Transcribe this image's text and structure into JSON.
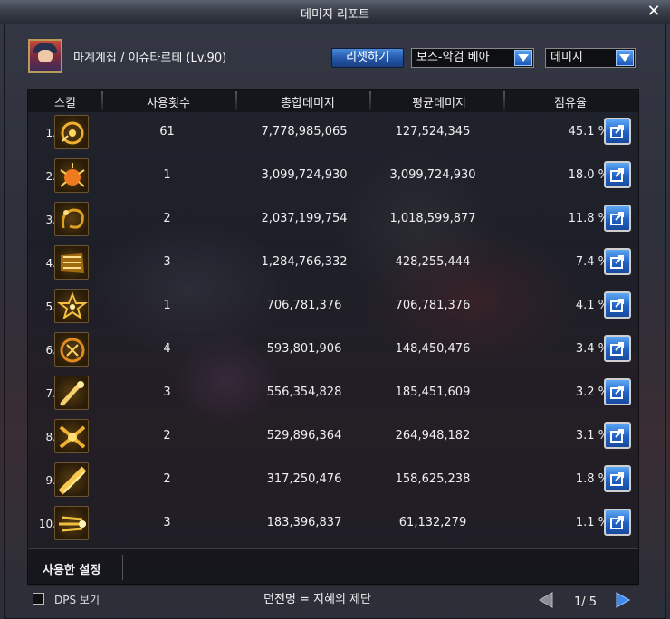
{
  "window": {
    "title": "데미지 리포트",
    "close_symbol": "✕"
  },
  "character": {
    "name": "마계계집 / 이슈타르테 (Lv.90)"
  },
  "controls": {
    "reset_label": "리셋하기",
    "target_select": "보스-악검 베아",
    "metric_select": "데미지"
  },
  "columns": {
    "skill": "스킬",
    "use_count": "사용횟수",
    "total_damage": "총합데미지",
    "avg_damage": "평균데미지",
    "share": "점유율"
  },
  "rows": [
    {
      "rank": "1.",
      "uses": "61",
      "total": "7,778,985,065",
      "avg": "127,524,345",
      "share": "45.1 %",
      "icon": "spiral-star-skill-icon"
    },
    {
      "rank": "2.",
      "uses": "1",
      "total": "3,099,724,930",
      "avg": "3,099,724,930",
      "share": "18.0 %",
      "icon": "flame-burst-skill-icon"
    },
    {
      "rank": "3.",
      "uses": "2",
      "total": "2,037,199,754",
      "avg": "1,018,599,877",
      "share": "11.8 %",
      "icon": "dark-swirl-skill-icon"
    },
    {
      "rank": "4.",
      "uses": "3",
      "total": "1,284,766,332",
      "avg": "428,255,444",
      "share": "7.4 %",
      "icon": "wave-slash-skill-icon"
    },
    {
      "rank": "5.",
      "uses": "1",
      "total": "706,781,376",
      "avg": "706,781,376",
      "share": "4.1 %",
      "icon": "star-burst-skill-icon"
    },
    {
      "rank": "6.",
      "uses": "4",
      "total": "593,801,906",
      "avg": "148,450,476",
      "share": "3.4 %",
      "icon": "flame-ring-skill-icon"
    },
    {
      "rank": "7.",
      "uses": "3",
      "total": "556,354,828",
      "avg": "185,451,609",
      "share": "3.2 %",
      "icon": "bat-swing-skill-icon"
    },
    {
      "rank": "8.",
      "uses": "2",
      "total": "529,896,364",
      "avg": "264,948,182",
      "share": "3.1 %",
      "icon": "cross-slash-skill-icon"
    },
    {
      "rank": "9.",
      "uses": "2",
      "total": "317,250,476",
      "avg": "158,625,238",
      "share": "1.8 %",
      "icon": "diagonal-strike-skill-icon"
    },
    {
      "rank": "10.",
      "uses": "3",
      "total": "183,396,837",
      "avg": "61,132,279",
      "share": "1.1 %",
      "icon": "dash-strike-skill-icon"
    }
  ],
  "settings": {
    "label": "사용한 설정"
  },
  "footer": {
    "dps_label": "DPS 보기",
    "dungeon": "던전명 = 지혜의 제단",
    "page": "1/ 5"
  },
  "colors": {
    "accent": "#2a66c8",
    "gold": "#e0a020"
  }
}
